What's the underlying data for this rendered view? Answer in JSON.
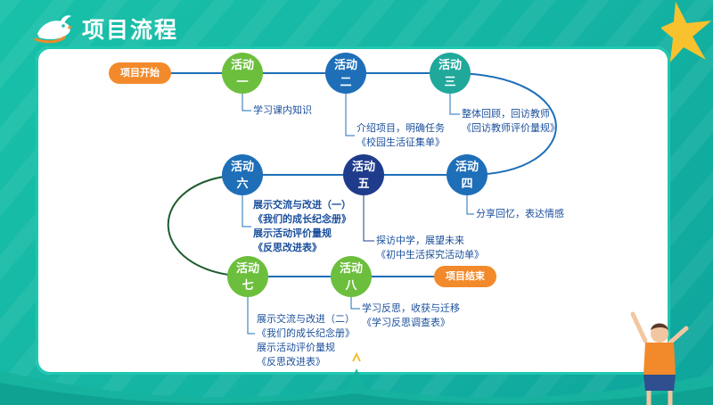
{
  "header": {
    "title": "项目流程"
  },
  "start_label": "项目开始",
  "end_label": "项目结束",
  "activities": [
    {
      "line1": "活动",
      "line2": "一"
    },
    {
      "line1": "活动",
      "line2": "二"
    },
    {
      "line1": "活动",
      "line2": "三"
    },
    {
      "line1": "活动",
      "line2": "四"
    },
    {
      "line1": "活动",
      "line2": "五"
    },
    {
      "line1": "活动",
      "line2": "六"
    },
    {
      "line1": "活动",
      "line2": "七"
    },
    {
      "line1": "活动",
      "line2": "八"
    }
  ],
  "captions": {
    "a1": [
      "学习课内知识"
    ],
    "a2": [
      "介绍项目，明确任务",
      "《校园生活征集单》"
    ],
    "a3": [
      "整体回顾，回访教师",
      "《回访教师评价量规》"
    ],
    "a4": [
      "分享回忆，表达情感"
    ],
    "a5": [
      "探访中学，展望未来",
      "《初中生活探究活动单》"
    ],
    "a6": [
      "展示交流与改进（一）",
      "《我们的成长纪念册》",
      "展示活动评价量规",
      "《反思改进表》"
    ],
    "a7": [
      "展示交流与改进（二）",
      "《我们的成长纪念册》",
      "展示活动评价量规",
      "《反思改进表》"
    ],
    "a8": [
      "学习反思，收获与迁移",
      "《学习反思调查表》"
    ]
  },
  "colors": {
    "green": "#6cbf3d",
    "teal": "#20a89b",
    "navy": "#1f3c8c",
    "blue": "#1e6fb8",
    "orange": "#f28a2b",
    "background": "#19c1a9"
  }
}
